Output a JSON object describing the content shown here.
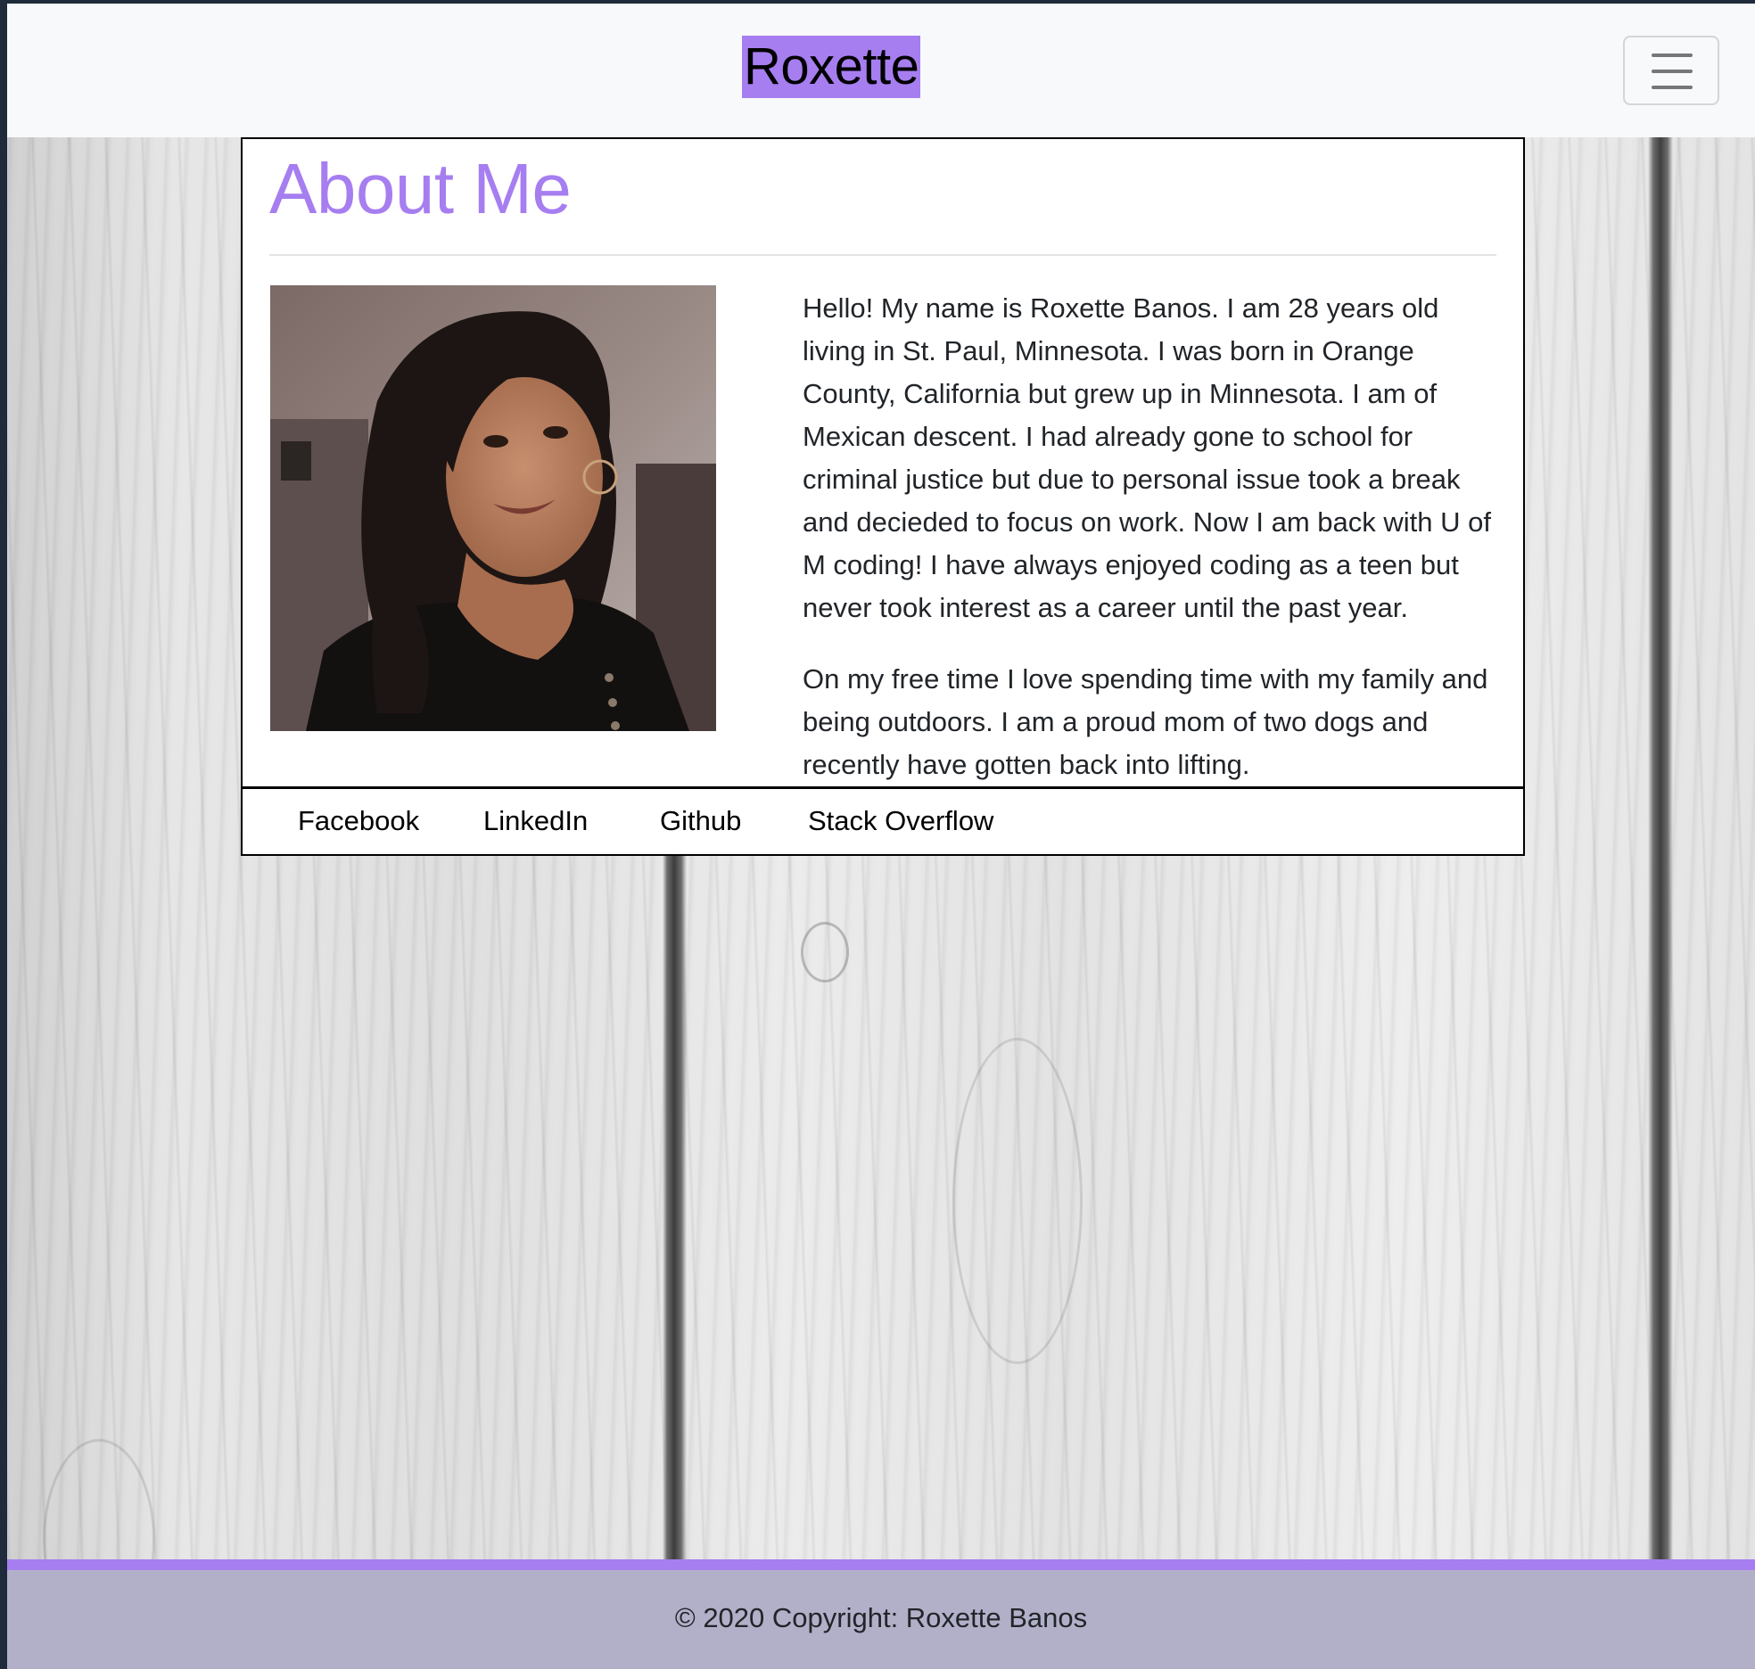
{
  "navbar": {
    "brand": "Roxette",
    "brand_highlight_color": "#a67ef0",
    "menu_icon": "hamburger-menu-icon"
  },
  "about": {
    "title": "About Me",
    "title_color": "#a67ef0",
    "photo_alt": "profile photo",
    "paragraphs": [
      "Hello! My name is Roxette Banos. I am 28 years old living in St. Paul, Minnesota. I was born in Orange County, California but grew up in Minnesota. I am of Mexican descent. I had already gone to school for criminal justice but due to personal issue took a break and decieded to focus on work. Now I am back with U of M coding! I have always enjoyed coding as a teen but never took interest as a career until the past year.",
      "On my free time I love spending time with my family and being outdoors. I am a proud mom of two dogs and recently have gotten back into lifting."
    ]
  },
  "links": [
    {
      "label": "Facebook"
    },
    {
      "label": "LinkedIn"
    },
    {
      "label": "Github"
    },
    {
      "label": "Stack Overflow"
    }
  ],
  "footer": {
    "text": "© 2020 Copyright: Roxette Banos",
    "accent_color": "#a67ef0",
    "background_color": "#b2b0c9"
  }
}
